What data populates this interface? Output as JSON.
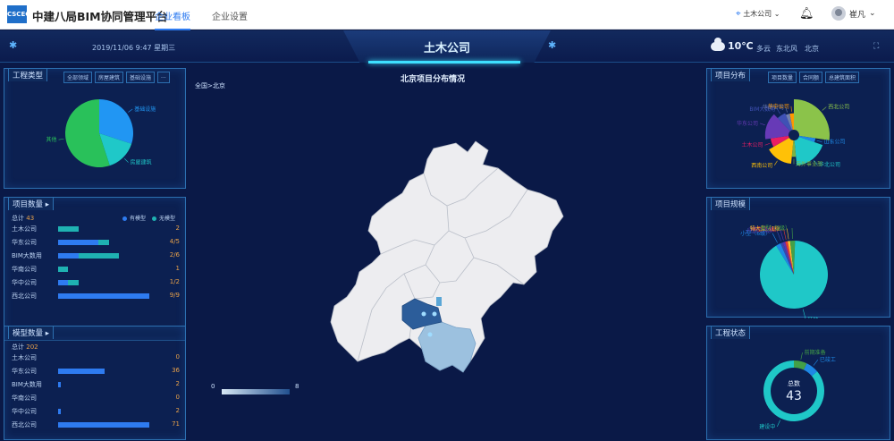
{
  "app": {
    "title": "中建八局BIM协同管理平台",
    "logo_text": "CSCEC"
  },
  "nav": [
    "企业看板",
    "企业设置"
  ],
  "topbar": {
    "company": "土木公司",
    "user": "崔凡"
  },
  "header": {
    "datetime": "2019/11/06 9:47 星期三",
    "title": "土木公司",
    "temperature": "10℃",
    "weather": "多云",
    "wind": "东北风",
    "city": "北京"
  },
  "engineering_type": {
    "title": "工程类型",
    "tabs": [
      "全部领域",
      "房屋建筑",
      "基础设施",
      "..."
    ],
    "chart_data": {
      "type": "pie",
      "labels": [
        "基础设施",
        "房屋建筑",
        "其他"
      ],
      "values": [
        30,
        15,
        55
      ],
      "colors": [
        "#2196f3",
        "#1fc8c8",
        "#29c15a"
      ]
    }
  },
  "project_count": {
    "title": "项目数量",
    "total_label": "总计",
    "total": "43",
    "legend": [
      "有模型",
      "无模型"
    ],
    "legend_colors": [
      "#2e7bf0",
      "#1fb2b2"
    ],
    "rows": [
      {
        "name": "土木公司",
        "value": "2",
        "with_model": 0,
        "without_model": 2
      },
      {
        "name": "华东公司",
        "value": "4/5",
        "with_model": 4,
        "without_model": 1
      },
      {
        "name": "BIM大数用",
        "value": "2/6",
        "with_model": 2,
        "without_model": 4
      },
      {
        "name": "华南公司",
        "value": "1",
        "with_model": 0,
        "without_model": 1
      },
      {
        "name": "华中公司",
        "value": "1/2",
        "with_model": 1,
        "without_model": 1
      },
      {
        "name": "西北公司",
        "value": "9/9",
        "with_model": 9,
        "without_model": 0
      }
    ],
    "max": 9
  },
  "model_count": {
    "title": "模型数量",
    "total_label": "总计",
    "total": "202",
    "rows": [
      {
        "name": "土木公司",
        "value": "0",
        "num": 0
      },
      {
        "name": "华东公司",
        "value": "36",
        "num": 36
      },
      {
        "name": "BIM大数用",
        "value": "2",
        "num": 2
      },
      {
        "name": "华南公司",
        "value": "0",
        "num": 0
      },
      {
        "name": "华中公司",
        "value": "2",
        "num": 2
      },
      {
        "name": "西北公司",
        "value": "71",
        "num": 71
      }
    ],
    "max": 71
  },
  "map": {
    "title": "北京项目分布情况",
    "breadcrumb": "全国>北京",
    "legend_min": "0",
    "legend_max": "8"
  },
  "project_distribution": {
    "title": "项目分布",
    "tabs": [
      "项目数量",
      "合同额",
      "总建筑面积"
    ],
    "chart_data": {
      "type": "pie",
      "labels": [
        "西北公司",
        "山东公司",
        "华北公司",
        "海外事业部",
        "西南公司",
        "土木公司",
        "华东公司",
        "BIM大数用",
        "华南公司",
        "华中公司"
      ],
      "values": [
        9,
        1,
        6,
        1,
        5,
        2,
        5,
        2,
        1,
        1
      ],
      "colors": [
        "#8bc34a",
        "#1e88e5",
        "#1fc8c8",
        "#7cb342",
        "#ffc107",
        "#e91e63",
        "#673ab7",
        "#3f51b5",
        "#6f7fb0",
        "#ff9800"
      ]
    }
  },
  "project_scale": {
    "title": "项目规模",
    "chart_data": {
      "type": "pie",
      "labels": [
        "小型（6级）",
        "大型（2级）",
        "中型（5级）",
        "中型（4级）",
        "特大型（1级...",
        "大型（3级）",
        "其他"
      ],
      "values": [
        1,
        0.5,
        0.5,
        0.5,
        0.5,
        1,
        39
      ],
      "colors": [
        "#1e88e5",
        "#3949ab",
        "#5e35b1",
        "#e53935",
        "#fbc02d",
        "#43a047",
        "#1fc8c8"
      ]
    }
  },
  "project_status": {
    "title": "工程状态",
    "center_label": "总数",
    "total": "43",
    "chart_data": {
      "type": "pie",
      "labels": [
        "前期准备",
        "已竣工",
        "建设中"
      ],
      "values": [
        3,
        3,
        37
      ],
      "colors": [
        "#43a047",
        "#1e88e5",
        "#1fc8c8"
      ]
    }
  }
}
